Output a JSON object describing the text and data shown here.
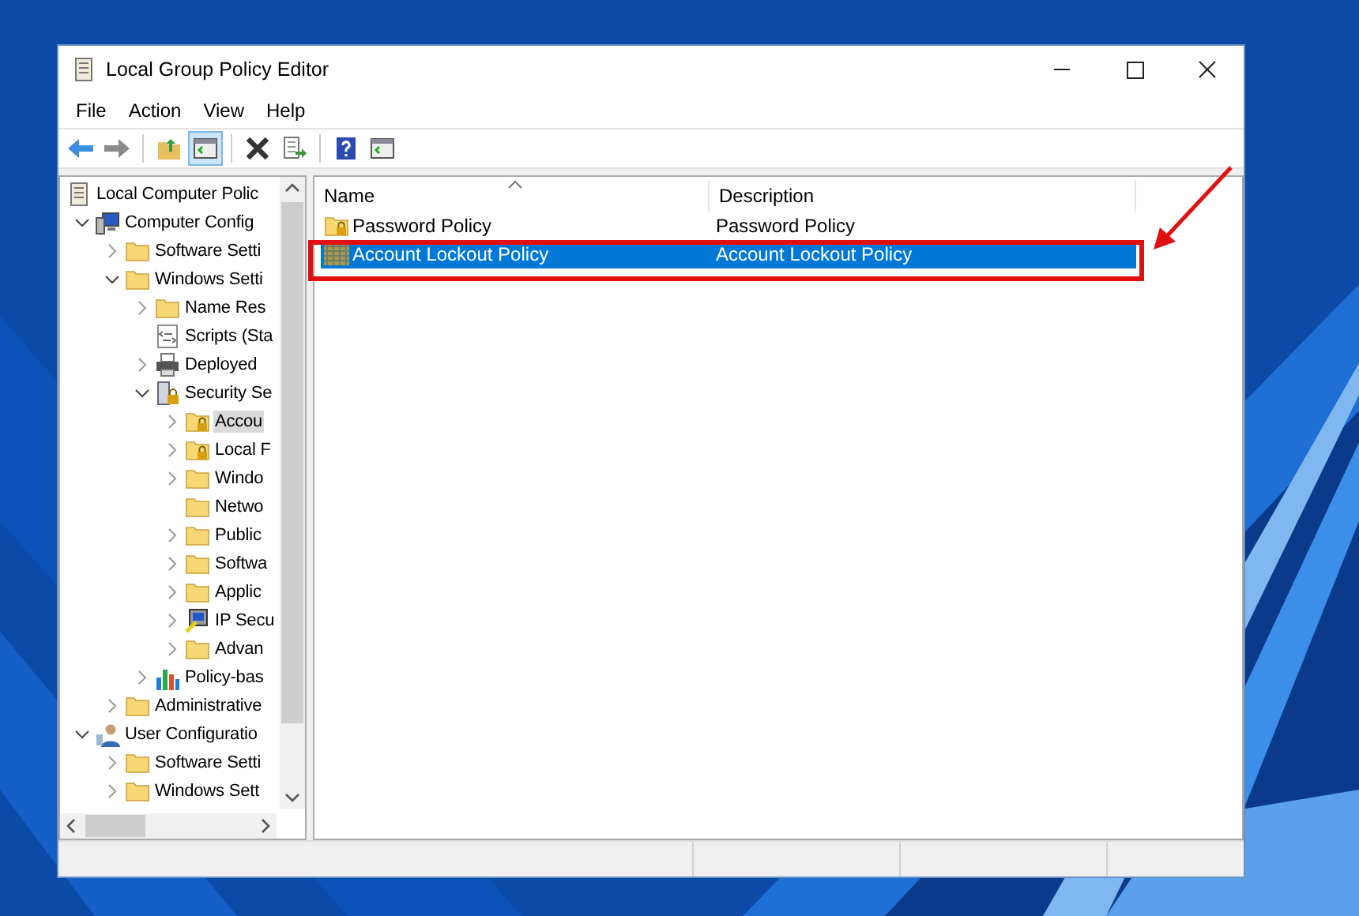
{
  "window": {
    "title": "Local Group Policy Editor"
  },
  "menu": [
    "File",
    "Action",
    "View",
    "Help"
  ],
  "toolbar": [
    {
      "kind": "back",
      "selected": false
    },
    {
      "kind": "forward",
      "selected": false
    },
    {
      "kind": "up",
      "selected": false
    },
    {
      "kind": "pane",
      "selected": true
    },
    {
      "kind": "delete",
      "selected": false
    },
    {
      "kind": "export",
      "selected": false
    },
    {
      "kind": "help",
      "selected": false
    },
    {
      "kind": "pane2",
      "selected": false
    }
  ],
  "tree": [
    {
      "label": "Local Computer Polic",
      "kind": "scroll",
      "selected": false,
      "children": [
        {
          "label": "Computer Config",
          "kind": "computer",
          "expanded": true,
          "selected": false,
          "children": [
            {
              "label": "Software Setti",
              "kind": "folder",
              "expanded": false,
              "selected": false
            },
            {
              "label": "Windows Setti",
              "kind": "folder",
              "expanded": true,
              "selected": false,
              "children": [
                {
                  "label": "Name Res",
                  "kind": "folder",
                  "expanded": false,
                  "selected": false
                },
                {
                  "label": "Scripts (Sta",
                  "kind": "script",
                  "selected": false
                },
                {
                  "label": "Deployed",
                  "kind": "printer",
                  "expanded": false,
                  "selected": false
                },
                {
                  "label": "Security Se",
                  "kind": "security",
                  "expanded": true,
                  "selected": false,
                  "children": [
                    {
                      "label": "Accou",
                      "kind": "lockfolder",
                      "expanded": false,
                      "selected": true
                    },
                    {
                      "label": "Local F",
                      "kind": "lockfolder",
                      "expanded": false,
                      "selected": false
                    },
                    {
                      "label": "Windo",
                      "kind": "folder",
                      "expanded": false,
                      "selected": false
                    },
                    {
                      "label": "Netwo",
                      "kind": "folder",
                      "selected": false
                    },
                    {
                      "label": "Public",
                      "kind": "folder",
                      "expanded": false,
                      "selected": false
                    },
                    {
                      "label": "Softwa",
                      "kind": "folder",
                      "expanded": false,
                      "selected": false
                    },
                    {
                      "label": "Applic",
                      "kind": "folder",
                      "expanded": false,
                      "selected": false
                    },
                    {
                      "label": "IP Secu",
                      "kind": "ip",
                      "expanded": false,
                      "selected": false
                    },
                    {
                      "label": "Advan",
                      "kind": "folder",
                      "expanded": false,
                      "selected": false
                    }
                  ]
                },
                {
                  "label": "Policy-bas",
                  "kind": "chart",
                  "expanded": false,
                  "selected": false
                }
              ]
            },
            {
              "label": "Administrative",
              "kind": "folder",
              "expanded": false,
              "selected": false
            }
          ]
        },
        {
          "label": "User Configuratio",
          "kind": "user",
          "expanded": true,
          "selected": false,
          "children": [
            {
              "label": "Software Setti",
              "kind": "folder",
              "expanded": false,
              "selected": false
            },
            {
              "label": "Windows Sett",
              "kind": "folder",
              "expanded": false,
              "selected": false
            }
          ]
        }
      ]
    }
  ],
  "list": {
    "columns": [
      "Name",
      "Description"
    ],
    "rows": [
      {
        "name": "Password Policy",
        "description": "Password Policy",
        "kind": "lockfolder",
        "selected": false
      },
      {
        "name": "Account Lockout Policy",
        "description": "Account Lockout Policy",
        "kind": "pattern",
        "selected": true
      }
    ]
  }
}
